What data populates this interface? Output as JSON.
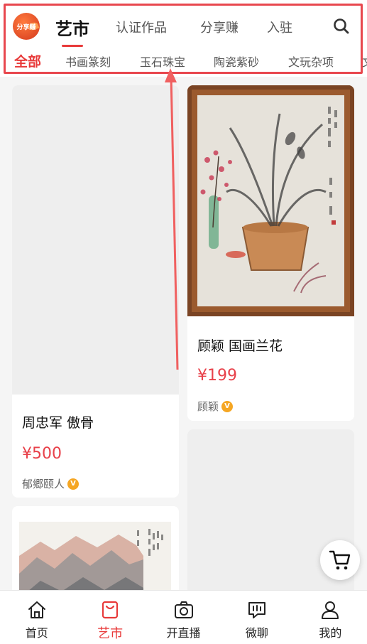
{
  "header": {
    "logo_text": "分享赚",
    "top_tabs": [
      {
        "label": "艺市",
        "active": true
      },
      {
        "label": "认证作品",
        "active": false
      },
      {
        "label": "分享赚",
        "active": false
      },
      {
        "label": "入驻",
        "active": false
      }
    ],
    "categories": [
      {
        "label": "全部",
        "active": true
      },
      {
        "label": "书画篆刻",
        "active": false
      },
      {
        "label": "玉石珠宝",
        "active": false
      },
      {
        "label": "陶瓷紫砂",
        "active": false
      },
      {
        "label": "文玩杂项",
        "active": false
      },
      {
        "label": "文",
        "active": false
      }
    ]
  },
  "feed": {
    "cards": [
      {
        "title": "周忠军 傲骨",
        "price": "¥500",
        "seller": "郁郷颐人"
      },
      {
        "title": "顾颖 国画兰花",
        "price": "¥199",
        "seller": "顾颖"
      },
      {
        "title": "",
        "price": "",
        "seller": ""
      },
      {
        "title": "",
        "price": "",
        "seller": ""
      }
    ]
  },
  "badge_text": "V",
  "bottom_nav": [
    {
      "label": "首页",
      "icon": "home-icon",
      "active": false
    },
    {
      "label": "艺市",
      "icon": "shopping-bag-icon",
      "active": true
    },
    {
      "label": "开直播",
      "icon": "camera-icon",
      "active": false
    },
    {
      "label": "微聊",
      "icon": "chat-icon",
      "active": false
    },
    {
      "label": "我的",
      "icon": "user-icon",
      "active": false
    }
  ],
  "colors": {
    "accent": "#e83a3a",
    "price": "#e8414a",
    "highlight_box": "#e8474e",
    "verified_badge": "#f5a623"
  }
}
